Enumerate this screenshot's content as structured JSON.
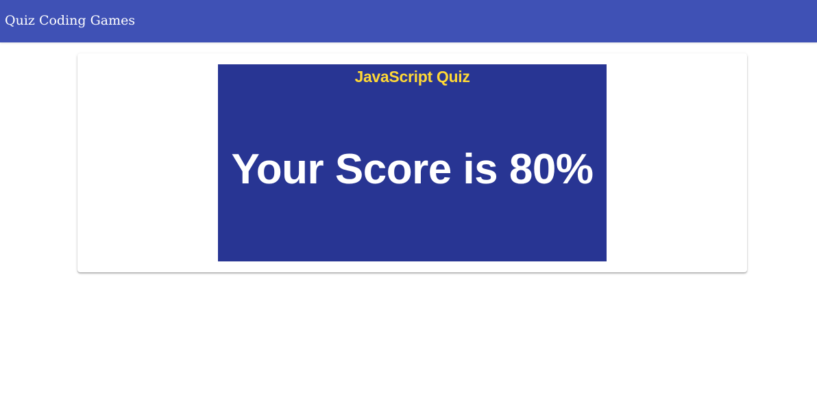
{
  "app": {
    "title": "Quiz Coding Games"
  },
  "quiz": {
    "title": "JavaScript Quiz",
    "score_text": "Your Score is 80%"
  },
  "colors": {
    "app_bar": "#3f51b5",
    "panel": "#283593",
    "quiz_title": "#ffd835",
    "score_text": "#ffffff"
  }
}
